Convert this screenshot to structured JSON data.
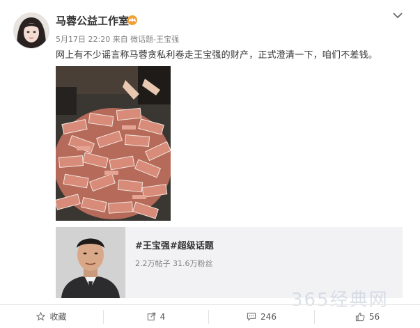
{
  "post": {
    "author": "马蓉公益工作室",
    "meta": "5月17日 22:20 来自 微话题-王宝强",
    "text": "网上有不少谣言称马蓉贪私利卷走王宝强的财产，正式澄清一下，咱们不差钱。"
  },
  "topic": {
    "title": "#王宝强#超级话题",
    "stats": "2.2万帖子 31.6万粉丝"
  },
  "footer": {
    "favorite": "收藏",
    "repost": "4",
    "comment": "246",
    "like": "56"
  },
  "icons": {
    "author_badge": "vip-crown-icon",
    "menu": "chevron-down-icon",
    "favorite": "star-icon",
    "repost": "share-arrow-icon",
    "comment": "comment-bubble-icon",
    "like": "thumb-up-icon"
  },
  "colors": {
    "badge": "#f0a030",
    "topic_bg": "#f2f2f5"
  }
}
